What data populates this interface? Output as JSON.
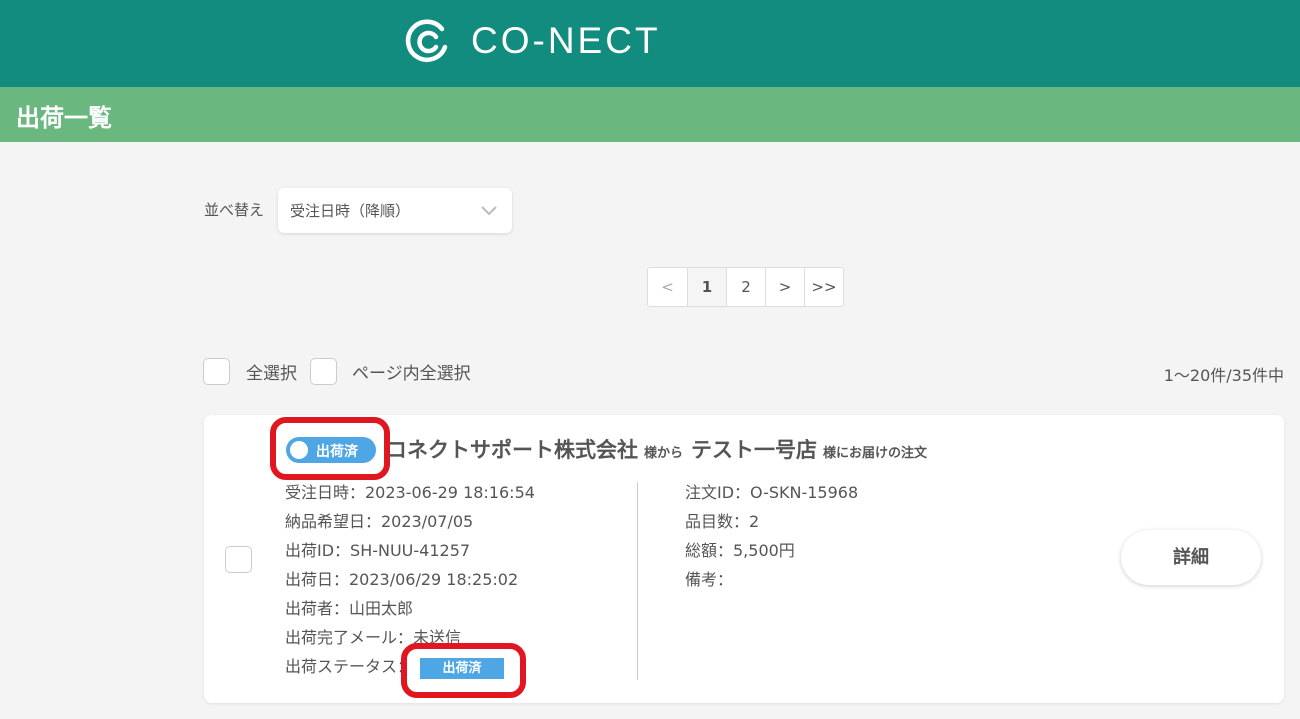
{
  "header": {
    "brand": "CO-NECT"
  },
  "page": {
    "title": "出荷一覧"
  },
  "sort": {
    "label": "並べ替え",
    "selected": "受注日時（降順）"
  },
  "pagination": {
    "prev": "<",
    "pages": [
      "1",
      "2"
    ],
    "current": "1",
    "next": ">",
    "last": ">>"
  },
  "selection": {
    "select_all": "全選択",
    "select_page": "ページ内全選択",
    "count": "1〜20件/35件中"
  },
  "order": {
    "toggle_label": "出荷済",
    "sender": "コネクトサポート株式会社",
    "from_suffix": "様から",
    "recipient": "テスト一号店",
    "to_suffix": "様にお届けの注文",
    "received_at": "受注日時：2023-06-29 18:16:54",
    "delivery_date": "納品希望日：2023/07/05",
    "shipment_id": "出荷ID：SH-NUU-41257",
    "shipped_at": "出荷日：2023/06/29 18:25:02",
    "shipper": "出荷者：山田太郎",
    "mail": "出荷完了メール：未送信",
    "status_label": "出荷ステータス：",
    "status_value": "出荷済",
    "order_id": "注文ID：O-SKN-15968",
    "item_count": "品目数：2",
    "total": "総額：5,500円",
    "note": "備考：",
    "detail_button": "詳細"
  },
  "colors": {
    "header": "#138c80",
    "page_bar": "#6ab77f",
    "badge": "#4fa6e4",
    "highlight": "#e01620"
  }
}
